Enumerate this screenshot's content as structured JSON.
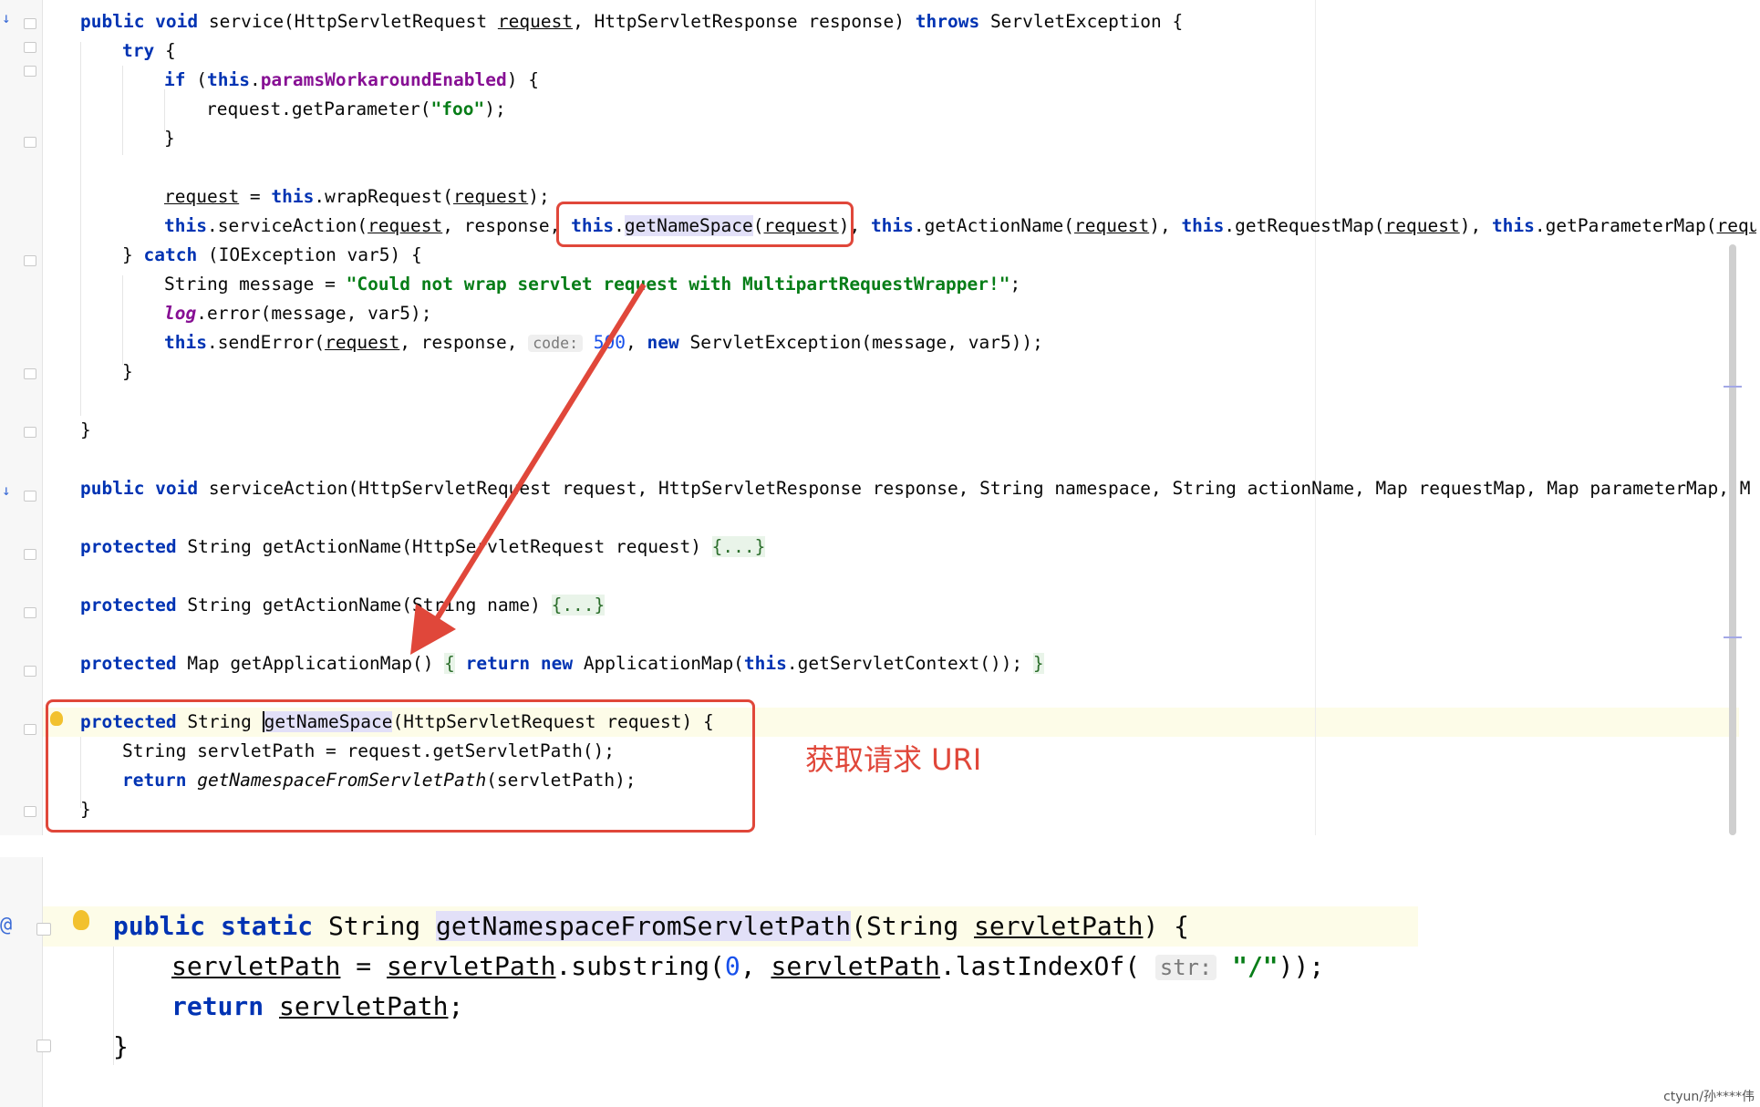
{
  "top_code": {
    "l1": {
      "a": "public void",
      "b": " service(HttpServletRequest ",
      "c": "request",
      "d": ", HttpServletResponse response) ",
      "e": "throws",
      "f": " ServletException {"
    },
    "l2": {
      "a": "try",
      "b": " {"
    },
    "l3": {
      "a": "if",
      "b": " (",
      "c": "this",
      ".": ".",
      "d": "paramsWorkaroundEnabled",
      "e": ") {"
    },
    "l4": {
      "a": "request.getParameter(",
      "b": "\"foo\"",
      "c": ");"
    },
    "l5": {
      "a": "}"
    },
    "l6": {
      "a": "request",
      "b": " = ",
      "c": "this",
      "d": ".wrapRequest(",
      "e": "request",
      "f": ");"
    },
    "l7": {
      "a": "this",
      "b": ".serviceAction(",
      "c": "request",
      "d": ", response, ",
      "e": "this",
      "f": ".",
      "g": "getNameSpace",
      "h": "(",
      "i": "request",
      "j": "), ",
      "k": "this",
      "l": ".getActionName(",
      "m": "request",
      "n": "), ",
      "o": "this",
      "p": ".getRequestMap(",
      "q": "request",
      "r": "), ",
      "s": "this",
      "t": ".getParameterMap(",
      "u": "requ"
    },
    "l8": {
      "a": "} ",
      "b": "catch",
      "c": " (IOException var5) {"
    },
    "l9": {
      "a": "String message = ",
      "b": "\"Could not wrap servlet request with MultipartRequestWrapper!\"",
      "c": ";"
    },
    "l10": {
      "a": "log",
      "b": ".error(message, var5);"
    },
    "l11": {
      "a": "this",
      "b": ".sendError(",
      "c": "request",
      "d": ", response, ",
      "e": "code:",
      "f": "500",
      "g": ", ",
      "h": "new",
      "i": " ServletException(message, var5));"
    },
    "l12": {
      "a": "}"
    },
    "l13": {
      "a": "}"
    },
    "l14": {
      "a": "public void",
      "b": " serviceAction(HttpServletRequest request, HttpServletResponse response, String namespace, String actionName, Map requestMap, Map parameterMap, M"
    },
    "l15": {
      "a": "protected",
      "b": " String getActionName(HttpServletRequest request) ",
      "c": "{...}"
    },
    "l16": {
      "a": "protected",
      "b": " String getActionName(String name) ",
      "c": "{...}"
    },
    "l17": {
      "a": "protected",
      "b": " Map getApplicationMap() ",
      "c": "{",
      "d": " ",
      "e": "return new",
      "f": " ApplicationMap(",
      "g": "this",
      "h": ".getServletContext()); ",
      "i": "}"
    },
    "l18": {
      "a": "protected",
      "b": " String ",
      "c": "getNameSpace",
      "d": "(HttpServletRequest request) {"
    },
    "l19": {
      "a": "String servletPath = request.getServletPath();"
    },
    "l20": {
      "a": "return",
      "b": " ",
      "c": "getNamespaceFromServletPath",
      "d": "(servletPath);"
    },
    "l21": {
      "a": "}"
    }
  },
  "annotation": "获取请求 URI",
  "bottom_code": {
    "l1": {
      "a": "public static",
      "b": " String ",
      "c": "getNamespaceFromServletPath",
      "d": "(String ",
      "e": "servletPath",
      "f": ") {"
    },
    "l2": {
      "a": "servletPath",
      "b": " = ",
      "c": "servletPath",
      "d": ".substring(",
      "e": "0",
      "f": ", ",
      "g": "servletPath",
      "h": ".lastIndexOf( ",
      "i": "str:",
      "j": " ",
      "k": "\"/\"",
      "l": "));"
    },
    "l3": {
      "a": "return",
      "b": " ",
      "c": "servletPath",
      "d": ";"
    },
    "l4": {
      "a": "}"
    }
  },
  "watermark": "ctyun/孙****伟",
  "colors": {
    "keyword": "#0033b3",
    "field": "#871094",
    "string": "#067d17",
    "number": "#1750eb",
    "annotation": "#e0473a"
  }
}
